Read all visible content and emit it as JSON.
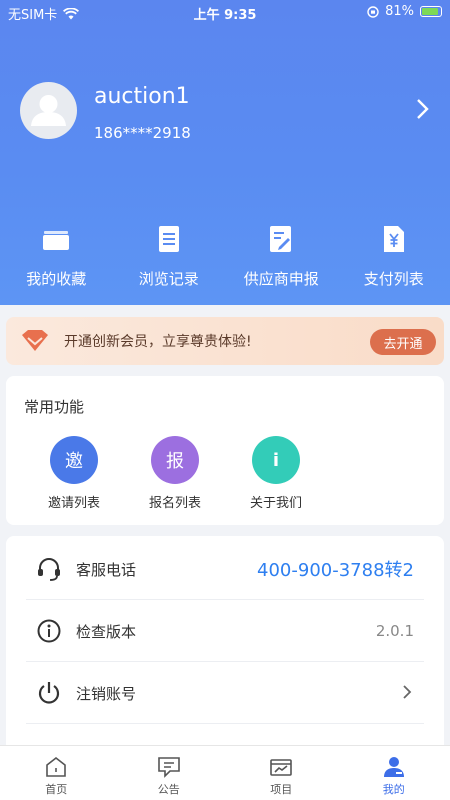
{
  "status_bar": {
    "carrier": "无SIM卡",
    "time": "上午 9:35",
    "battery": "81%"
  },
  "profile": {
    "name": "auction1",
    "phone": "186****2918"
  },
  "quick_menu": [
    {
      "label": "我的收藏",
      "icon": "folder-icon"
    },
    {
      "label": "浏览记录",
      "icon": "document-icon"
    },
    {
      "label": "供应商申报",
      "icon": "edit-document-icon"
    },
    {
      "label": "支付列表",
      "icon": "yen-document-icon"
    }
  ],
  "vip_banner": {
    "text": "开通创新会员，立享尊贵体验!",
    "button": "去开通"
  },
  "common": {
    "title": "常用功能",
    "items": [
      {
        "label": "邀请列表",
        "glyph": "邀",
        "color": "#4a79e8"
      },
      {
        "label": "报名列表",
        "glyph": "报",
        "color": "#9c6fe0"
      },
      {
        "label": "关于我们",
        "glyph": "i",
        "color": "#33ccb8"
      }
    ]
  },
  "settings": [
    {
      "label": "客服电话",
      "value": "400-900-3788转2"
    },
    {
      "label": "检查版本",
      "value": "2.0.1"
    },
    {
      "label": "注销账号",
      "value": ""
    }
  ],
  "tabbar": [
    {
      "label": "首页",
      "active": false
    },
    {
      "label": "公告",
      "active": false
    },
    {
      "label": "项目",
      "active": false
    },
    {
      "label": "我的",
      "active": true
    }
  ]
}
